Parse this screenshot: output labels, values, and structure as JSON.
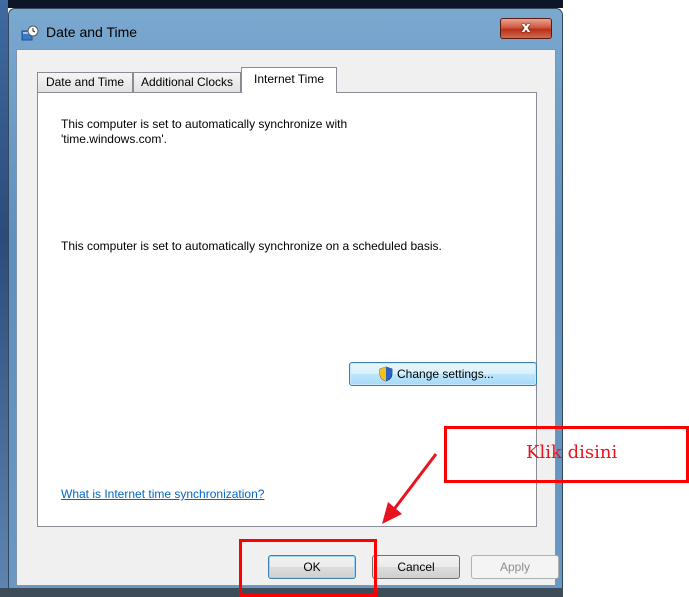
{
  "window": {
    "title": "Date and Time",
    "close_glyph": "x"
  },
  "tabs": [
    {
      "label": "Date and Time",
      "active": false
    },
    {
      "label": "Additional Clocks",
      "active": false
    },
    {
      "label": "Internet Time",
      "active": true
    }
  ],
  "panel": {
    "sync_line1": "This computer is set to automatically synchronize with",
    "sync_line2": "'time.windows.com'.",
    "schedule_text": "This computer is set to automatically synchronize on a scheduled basis.",
    "change_button": "Change settings...",
    "help_link": "What is Internet time synchronization?"
  },
  "buttons": {
    "ok": "OK",
    "cancel": "Cancel",
    "apply": "Apply"
  },
  "annotation": {
    "callout": "Klik disini",
    "color": "#ff0000"
  },
  "icons": [
    "clock-icon",
    "close-icon",
    "uac-shield-icon",
    "arrow-icon"
  ]
}
